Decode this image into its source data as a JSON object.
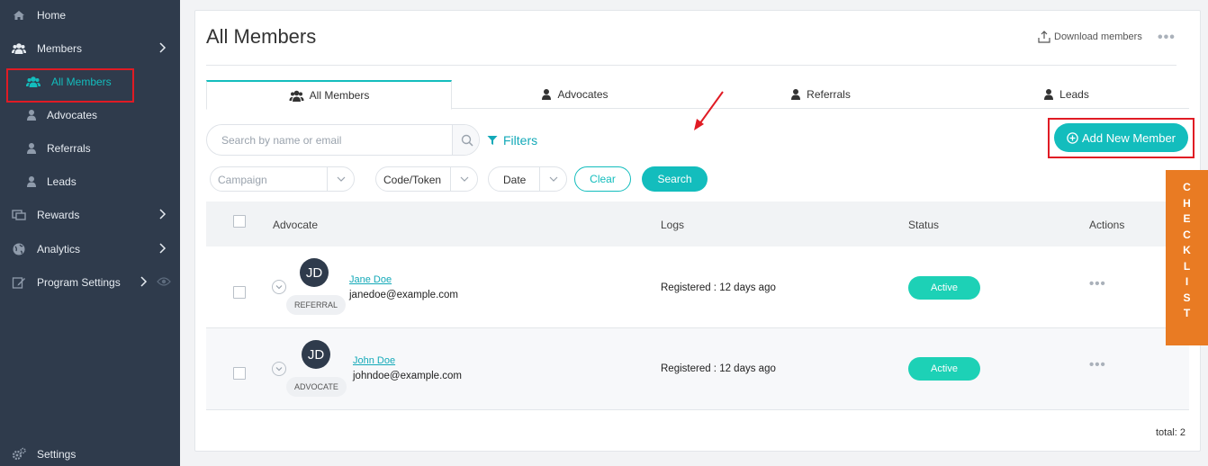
{
  "sidebar": {
    "items": [
      {
        "label": "Home",
        "icon": "home-icon"
      },
      {
        "label": "Members",
        "icon": "users-icon"
      },
      {
        "label": "All Members",
        "icon": "users-icon",
        "active": true
      },
      {
        "label": "Advocates",
        "icon": "user-icon"
      },
      {
        "label": "Referrals",
        "icon": "user-icon"
      },
      {
        "label": "Leads",
        "icon": "user-icon"
      },
      {
        "label": "Rewards",
        "icon": "gift-card-icon"
      },
      {
        "label": "Analytics",
        "icon": "globe-icon"
      },
      {
        "label": "Program Settings",
        "icon": "edit-icon"
      },
      {
        "label": "Settings",
        "icon": "gears-icon"
      }
    ]
  },
  "header": {
    "title": "All Members",
    "download_label": "Download members",
    "more_label": "•••"
  },
  "tabs": [
    {
      "label": "All Members",
      "active": true
    },
    {
      "label": "Advocates"
    },
    {
      "label": "Referrals"
    },
    {
      "label": "Leads"
    }
  ],
  "search": {
    "placeholder": "Search by name or email",
    "filters_label": "Filters"
  },
  "add_button": "Add New Member",
  "filters": {
    "campaign_placeholder": "Campaign",
    "code_label": "Code/Token",
    "date_label": "Date",
    "clear_label": "Clear",
    "search_label": "Search"
  },
  "table": {
    "columns": [
      "Advocate",
      "Logs",
      "Status",
      "Actions"
    ],
    "rows": [
      {
        "initials": "JD",
        "tag": "REFERRAL",
        "name": "Jane Doe",
        "email": "janedoe@example.com",
        "logs": "Registered : 12 days ago",
        "status": "Active",
        "actions": "•••"
      },
      {
        "initials": "JD",
        "tag": "ADVOCATE",
        "name": "John Doe",
        "email": "johndoe@example.com",
        "logs": "Registered : 12 days ago",
        "status": "Active",
        "actions": "•••"
      }
    ],
    "total": "total: 2"
  },
  "checklist": [
    "C",
    "H",
    "E",
    "C",
    "K",
    "L",
    "I",
    "S",
    "T"
  ],
  "colors": {
    "sidebar_bg": "#2f3b4c",
    "accent": "#13bdbd",
    "status_active": "#1dd1b6",
    "checklist_bg": "#e97b23",
    "highlight": "#e01b24"
  }
}
